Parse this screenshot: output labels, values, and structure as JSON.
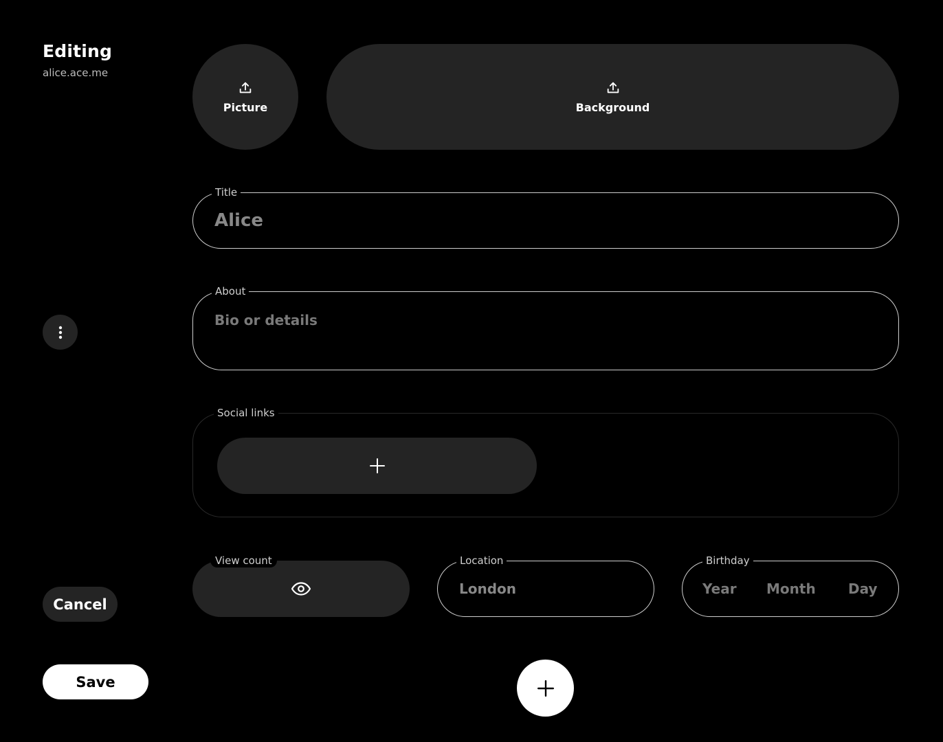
{
  "sidebar": {
    "heading": "Editing",
    "subheading": "alice.ace.me",
    "menu_icon": "more-vertical-icon",
    "cancel_label": "Cancel",
    "save_label": "Save"
  },
  "uploads": {
    "picture_label": "Picture",
    "background_label": "Background",
    "icon": "upload-icon"
  },
  "fields": {
    "title": {
      "label": "Title",
      "value": "Alice"
    },
    "about": {
      "label": "About",
      "placeholder": "Bio or details"
    },
    "social_links": {
      "label": "Social links",
      "add_icon": "plus-icon"
    },
    "view_count": {
      "label": "View count",
      "icon": "eye-icon"
    },
    "location": {
      "label": "Location",
      "value": "London"
    },
    "birthday": {
      "label": "Birthday",
      "year": "Year",
      "month": "Month",
      "day": "Day"
    }
  },
  "fab": {
    "icon": "plus-icon"
  },
  "colors": {
    "background": "#000000",
    "surface": "#242424",
    "border": "#cfcfcf",
    "text_muted": "#888888",
    "primary_button": "#ffffff"
  }
}
